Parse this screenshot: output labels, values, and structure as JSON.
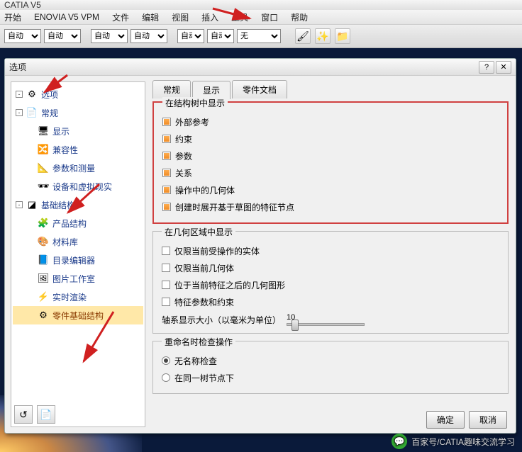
{
  "title": "CATIA V5",
  "menu": [
    "开始",
    "ENOVIA V5 VPM",
    "文件",
    "编辑",
    "视图",
    "插入",
    "工具",
    "窗口",
    "帮助"
  ],
  "toolbar_selects": [
    "自动",
    "自动",
    "自动",
    "自动",
    "自动",
    "自动",
    "无"
  ],
  "toolbar_select_widths": [
    52,
    52,
    52,
    52,
    38,
    38,
    62
  ],
  "dialog": {
    "title": "选项",
    "tabs": [
      "常规",
      "显示",
      "零件文档"
    ],
    "active_tab": 1,
    "tree": [
      {
        "label": "选项",
        "icon": "⚙",
        "kind": "root",
        "exp": "-"
      },
      {
        "label": "常规",
        "icon": "📄",
        "kind": "root",
        "exp": "-"
      },
      {
        "label": "显示",
        "icon": "🖥",
        "kind": "child"
      },
      {
        "label": "兼容性",
        "icon": "🔀",
        "kind": "child"
      },
      {
        "label": "参数和测量",
        "icon": "📐",
        "kind": "child"
      },
      {
        "label": "设备和虚拟现实",
        "icon": "🕶",
        "kind": "child"
      },
      {
        "label": "基础结构",
        "icon": "◪",
        "kind": "root",
        "exp": "-"
      },
      {
        "label": "产品结构",
        "icon": "🧩",
        "kind": "child"
      },
      {
        "label": "材料库",
        "icon": "🎨",
        "kind": "child"
      },
      {
        "label": "目录编辑器",
        "icon": "📘",
        "kind": "child"
      },
      {
        "label": "图片工作室",
        "icon": "🖼",
        "kind": "child"
      },
      {
        "label": "实时渲染",
        "icon": "⚡",
        "kind": "child"
      },
      {
        "label": "零件基础结构",
        "icon": "⚙",
        "kind": "child",
        "sel": true
      }
    ],
    "group1": {
      "legend": "在结构树中显示",
      "items": [
        "外部参考",
        "约束",
        "参数",
        "关系",
        "操作中的几何体",
        "创建时展开基于草图的特征节点"
      ]
    },
    "group2": {
      "legend": "在几何区域中显示",
      "items": [
        "仅限当前受操作的实体",
        "仅限当前几何体",
        "位于当前特征之后的几何图形",
        "特征参数和约束"
      ],
      "slider_label": "轴系显示大小（以毫米为单位）",
      "slider_value": "10"
    },
    "group3": {
      "legend": "重命名时检查操作",
      "radios": [
        "无名称检查",
        "在同一树节点下"
      ]
    },
    "buttons": {
      "ok": "确定",
      "cancel": "取消"
    }
  },
  "watermark": "百家号/CATIA趣味交流学习"
}
